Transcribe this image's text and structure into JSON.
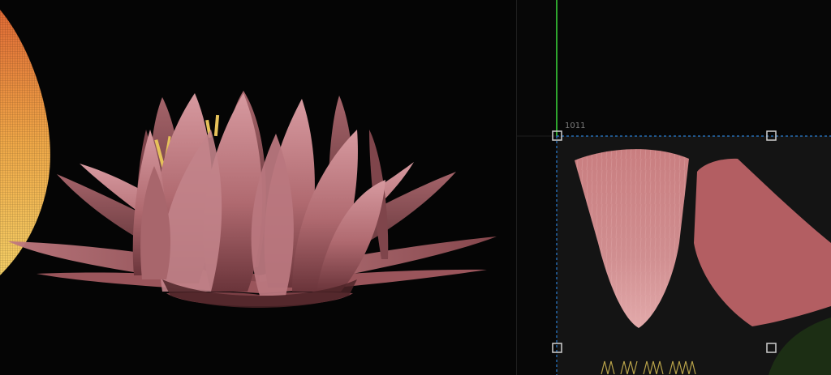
{
  "uv_editor": {
    "tile_label": "1011",
    "colors": {
      "v_axis": "#2ea52e",
      "tile_border": "#2a7fd4",
      "handle": "#cfcfcf",
      "petal_a": "#c77a7a",
      "petal_b": "#b35e62",
      "leaf": "#1c2e14"
    }
  },
  "viewport": {
    "object": "water-lily-model",
    "colors": {
      "petal_light": "#c98a8c",
      "petal_dark": "#6e3a40",
      "stamen": "#e8c35a",
      "wire_gradient_start": "#e07a3a",
      "wire_gradient_end": "#f3c15a"
    }
  }
}
